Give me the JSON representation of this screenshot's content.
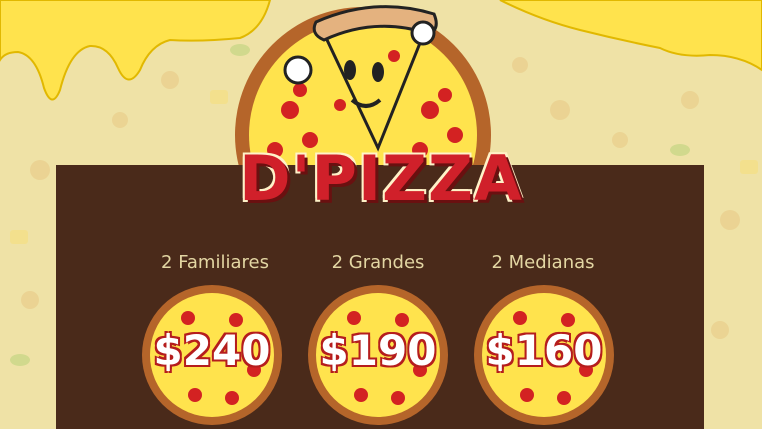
{
  "brand": "D'PIZZA",
  "offers": [
    {
      "label": "2 Familiares",
      "price": "$240"
    },
    {
      "label": "2 Grandes",
      "price": "$190"
    },
    {
      "label": "2 Medianas",
      "price": "$160"
    }
  ],
  "colors": {
    "background": "#efe2a6",
    "panel": "#4a2a1a",
    "brand": "#d0202a",
    "cheese": "#ffe34d",
    "pepperoni": "#d32222",
    "crust": "#b5652a"
  },
  "icons": [
    "pizza-mascot-icon",
    "pizza-icon"
  ]
}
